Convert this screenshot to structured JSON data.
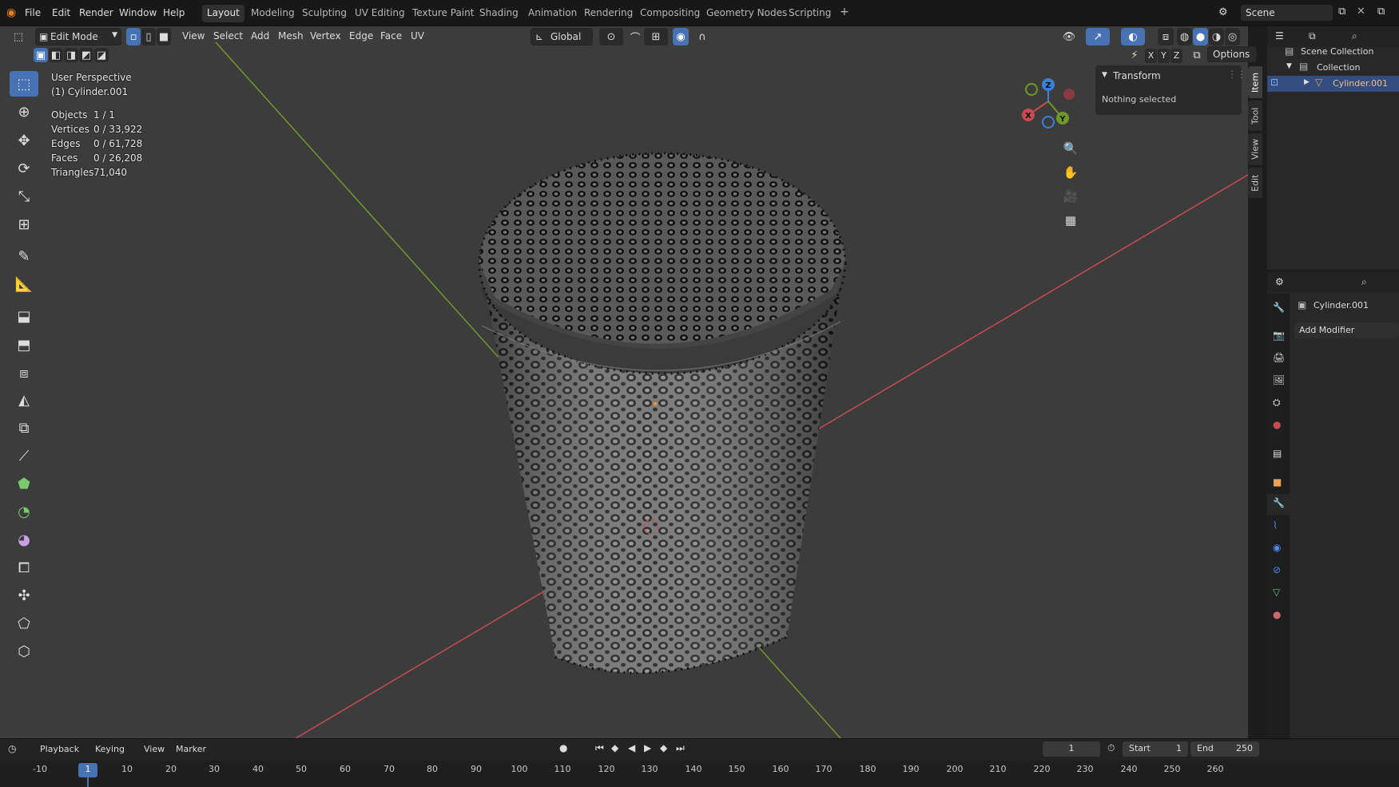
{
  "menu": {
    "file": "File",
    "edit": "Edit",
    "render": "Render",
    "window": "Window",
    "help": "Help"
  },
  "workspaces": [
    "Layout",
    "Modeling",
    "Sculpting",
    "UV Editing",
    "Texture Paint",
    "Shading",
    "Animation",
    "Rendering",
    "Compositing",
    "Geometry Nodes",
    "Scripting"
  ],
  "workspace_add": "+",
  "scene": {
    "label": "Scene"
  },
  "viewport_header": {
    "mode": "Edit Mode",
    "view": "View",
    "select": "Select",
    "add": "Add",
    "mesh": "Mesh",
    "vertex": "Vertex",
    "edge": "Edge",
    "face": "Face",
    "uv": "UV",
    "orientation": "Global",
    "options": "Options",
    "axis_x": "X",
    "axis_y": "Y",
    "axis_z": "Z"
  },
  "overlay": {
    "perspective": "User Perspective",
    "object": "(1) Cylinder.001",
    "stats": [
      {
        "label": "Objects",
        "value": "1 / 1"
      },
      {
        "label": "Vertices",
        "value": "0 / 33,922"
      },
      {
        "label": "Edges",
        "value": "0 / 61,728"
      },
      {
        "label": "Faces",
        "value": "0 / 26,208"
      },
      {
        "label": "Triangles",
        "value": "71,040"
      }
    ]
  },
  "gizmo": {
    "x": "X",
    "y": "Y",
    "z": "Z"
  },
  "npanel": {
    "title": "Transform",
    "message": "Nothing selected",
    "tabs": [
      "Item",
      "Tool",
      "View",
      "Edit"
    ]
  },
  "outliner": {
    "scene_collection": "Scene Collection",
    "collection": "Collection",
    "object": "Cylinder.001"
  },
  "properties": {
    "object": "Cylinder.001",
    "add_modifier": "Add Modifier"
  },
  "timeline": {
    "playback": "Playback",
    "keying": "Keying",
    "view": "View",
    "marker": "Marker",
    "current_frame": "1",
    "start_label": "Start",
    "start": "1",
    "end_label": "End",
    "end": "250",
    "ticks": [
      "-10",
      "1",
      "10",
      "20",
      "30",
      "40",
      "50",
      "60",
      "70",
      "80",
      "90",
      "100",
      "110",
      "120",
      "130",
      "140",
      "150",
      "160",
      "170",
      "180",
      "190",
      "200",
      "210",
      "220",
      "230",
      "240",
      "250",
      "260"
    ]
  },
  "colors": {
    "accent": "#4772b3",
    "x_axis": "#c94b52",
    "y_axis": "#6f9a2a",
    "z_axis": "#3d7fd6",
    "bg": "#3c3c3c"
  }
}
